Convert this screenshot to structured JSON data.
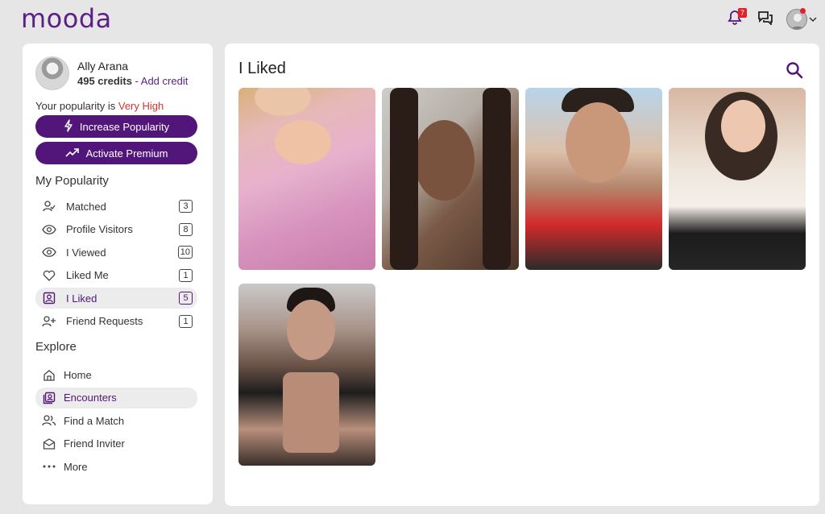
{
  "app": {
    "logo": "mooda"
  },
  "topbar": {
    "notification_count": "7"
  },
  "profile": {
    "name": "Ally Arana",
    "credits": "495 credits",
    "separator": " - ",
    "add_credit": "Add credit",
    "popularity_prefix": "Your popularity is ",
    "popularity_value": "Very High"
  },
  "buttons": {
    "increase": "Increase Popularity",
    "premium": "Activate Premium"
  },
  "my_popularity": {
    "title": "My Popularity",
    "items": [
      {
        "label": "Matched",
        "count": "3",
        "icon": "user-check-icon"
      },
      {
        "label": "Profile Visitors",
        "count": "8",
        "icon": "eye-icon"
      },
      {
        "label": "I Viewed",
        "count": "10",
        "icon": "eye-icon"
      },
      {
        "label": "Liked Me",
        "count": "1",
        "icon": "heart-icon"
      },
      {
        "label": "I Liked",
        "count": "5",
        "icon": "contact-icon",
        "active": true
      },
      {
        "label": "Friend Requests",
        "count": "1",
        "icon": "user-plus-icon"
      }
    ]
  },
  "explore": {
    "title": "Explore",
    "items": [
      {
        "label": "Home",
        "icon": "home-icon"
      },
      {
        "label": "Encounters",
        "icon": "encounters-icon",
        "active": true
      },
      {
        "label": "Find a Match",
        "icon": "users-icon"
      },
      {
        "label": "Friend Inviter",
        "icon": "envelope-icon"
      },
      {
        "label": "More",
        "icon": "more-icon"
      }
    ]
  },
  "main": {
    "title": "I Liked"
  },
  "colors": {
    "brand": "#52167a",
    "accent_red": "#d8322e",
    "badge": "#e0202a"
  }
}
